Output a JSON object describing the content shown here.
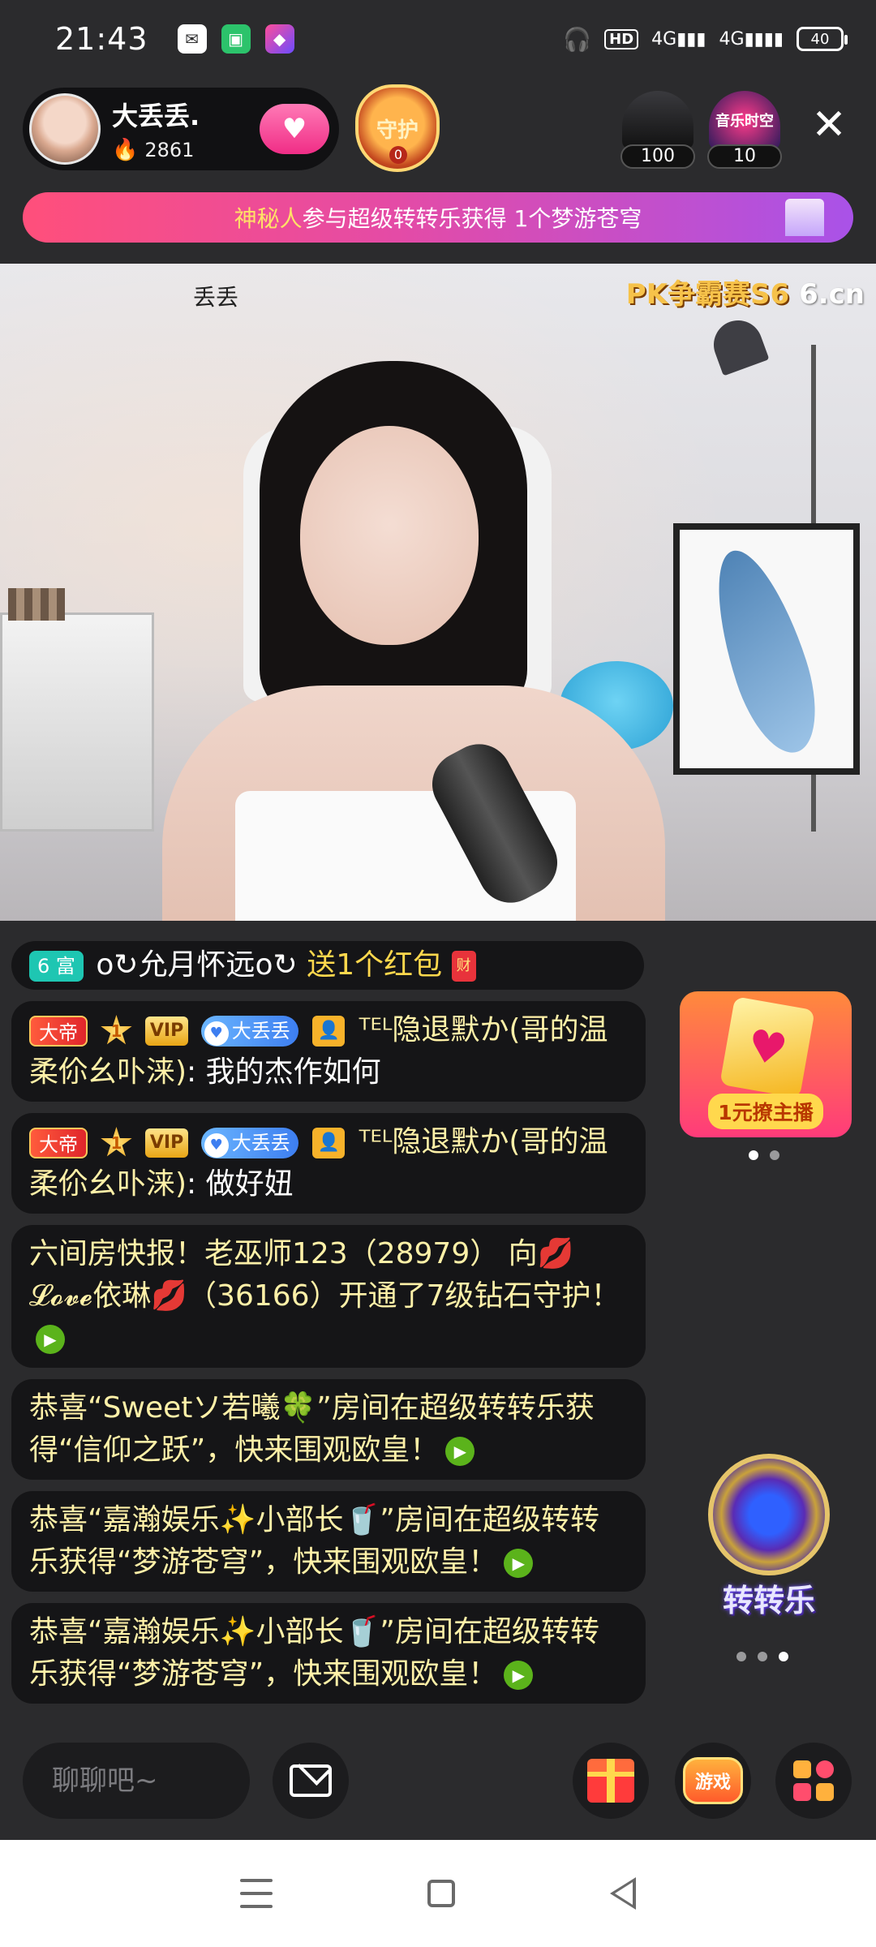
{
  "status_bar": {
    "time": "21:43",
    "network_label": "HD",
    "signal_label_1": "4G",
    "signal_label_2": "4G",
    "battery": "40",
    "icons": [
      "wechat-icon",
      "app-icon",
      "app-icon",
      "headphones-icon",
      "signal-icon",
      "battery-icon"
    ]
  },
  "host": {
    "name": "大丢丢.",
    "heat": "2861"
  },
  "guard": {
    "label": "守护",
    "count": "0"
  },
  "badges": [
    {
      "label": "",
      "count": "100"
    },
    {
      "label": "音乐时空",
      "count": "10"
    }
  ],
  "banner": {
    "highlight": "神秘人",
    "text": "参与超级转转乐获得 1个梦游苍穹"
  },
  "video": {
    "anchor_label": "丢丢",
    "watermark": "PK争霸赛S6",
    "watermark_domain": "6.cn"
  },
  "chat": [
    {
      "level_tag": "6 富",
      "user": "o↻允月怀远o↻",
      "content": "送1个红包",
      "envelope": "财"
    },
    {
      "rank_tag": "大帝",
      "star": "1",
      "vip": "VIP",
      "fan_tag": "大丢丢",
      "nick": "ᵀᴱᴸ隐退默か(哥的温柔伱幺卟涞)",
      "content": ": 我的杰作如何"
    },
    {
      "rank_tag": "大帝",
      "star": "1",
      "vip": "VIP",
      "fan_tag": "大丢丢",
      "nick": "ᵀᴱᴸ隐退默か(哥的温柔伱幺卟涞)",
      "content": ": 做好妞"
    },
    {
      "text": " 六间房快报！老巫师123（28979） 向💋𝓛𝓸𝓿𝓮依琳💋（36166）开通了7级钻石守护！"
    },
    {
      "text": "恭喜“Sweetソ若曦🍀”房间在超级转转乐获得“信仰之跃”，快来围观欧皇！"
    },
    {
      "text": "恭喜“嘉瀚娱乐✨小部长🥤”房间在超级转转乐获得“梦游苍穹”，快来围观欧皇！"
    },
    {
      "text": "恭喜“嘉瀚娱乐✨小部长🥤”房间在超级转转乐获得“梦游苍穹”，快来围观欧皇！"
    }
  ],
  "promo": {
    "label": "1元撩主播"
  },
  "wheel": {
    "label": "转转乐"
  },
  "bottom_bar": {
    "chat_placeholder": "聊聊吧~",
    "game_label": "游戏"
  },
  "colors": {
    "background": "#2b2b2d",
    "accent_pink": "#f02d86",
    "gold": "#ffd84d",
    "go_green": "#5bb31b"
  }
}
